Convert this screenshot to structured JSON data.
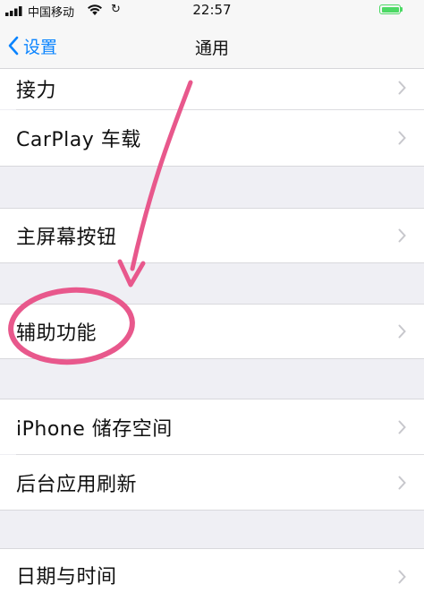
{
  "status_bar": {
    "carrier": "中国移动",
    "time": "22:57"
  },
  "nav": {
    "back_label": "设置",
    "title": "通用"
  },
  "rows": [
    {
      "label": "接力"
    },
    {
      "label": "CarPlay 车载"
    },
    {
      "label": "主屏幕按钮"
    },
    {
      "label": "辅助功能"
    },
    {
      "label": "iPhone 储存空间"
    },
    {
      "label": "后台应用刷新"
    },
    {
      "label": "日期与时间"
    }
  ],
  "annotation": {
    "color": "#e8588c",
    "highlighted_item": "辅助功能"
  }
}
